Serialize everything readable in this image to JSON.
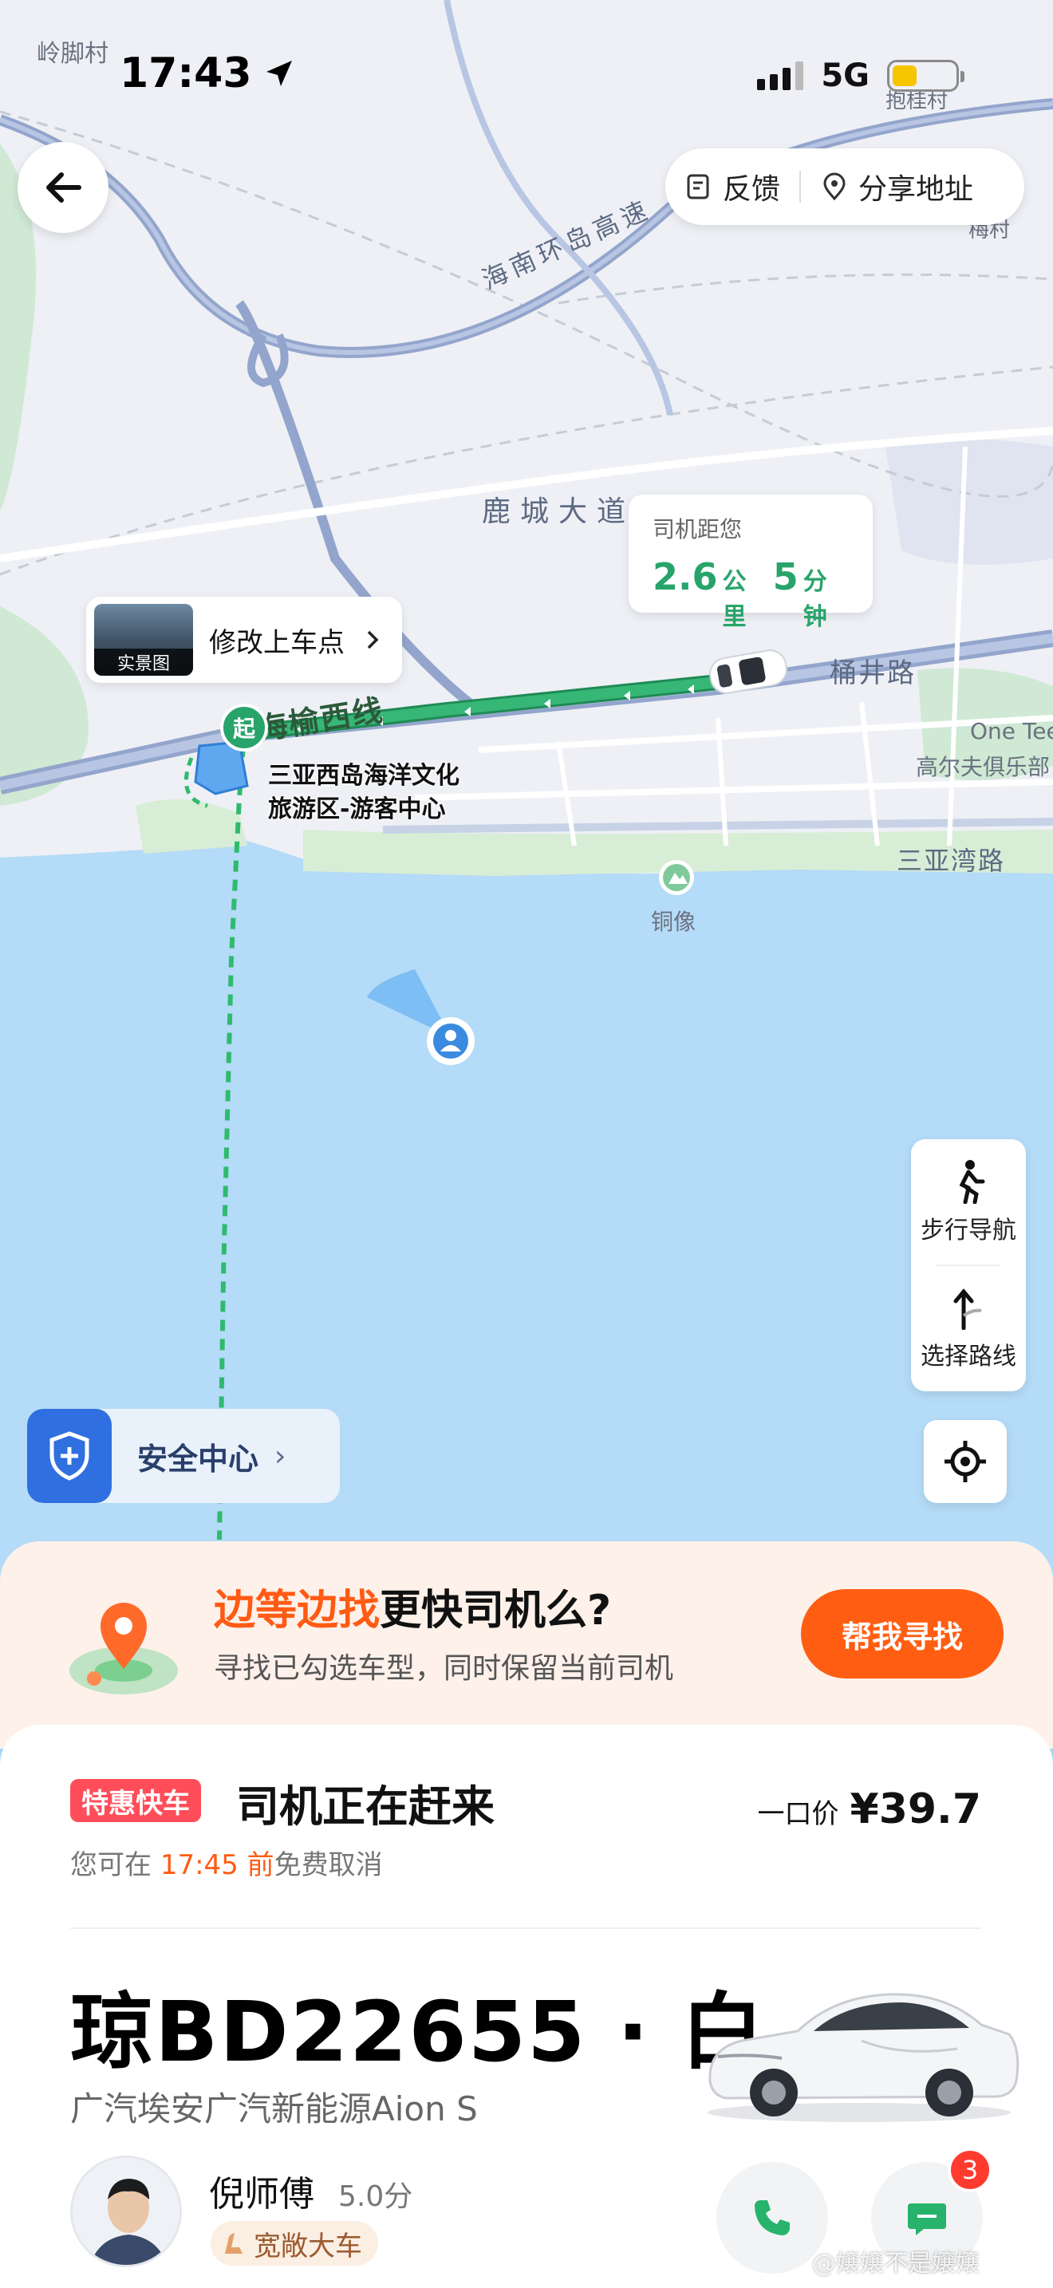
{
  "status_bar": {
    "time": "17:43",
    "network": "5G"
  },
  "map": {
    "labels": {
      "top_left_village": "岭脚村",
      "top_right_village": "抱桂村",
      "right_village": "梅村",
      "highway": "海南环岛高速",
      "lucheng": "鹿城大道",
      "yuxi": "海榆西线",
      "tongjing": "桶井路",
      "sanyawan": "三亚湾路",
      "golf": "高尔夫俱乐部",
      "golf_en": "One Tee",
      "statue": "铜像"
    },
    "pickup_marker": "起",
    "poi_line1": "三亚西岛海洋文化",
    "poi_line2": "旅游区-游客中心"
  },
  "top_actions": {
    "feedback": "反馈",
    "share": "分享地址"
  },
  "eta": {
    "title": "司机距您",
    "distance": "2.6",
    "distance_unit": "公里",
    "minutes": "5",
    "minutes_unit": "分钟"
  },
  "pickup_card": {
    "thumb_tag": "实景图",
    "label": "修改上车点"
  },
  "right_panel": {
    "walk": "步行导航",
    "route": "选择路线"
  },
  "safety": {
    "label": "安全中心"
  },
  "promo": {
    "title_highlight": "边等边找",
    "title_rest": "更快司机么?",
    "subtitle": "寻找已勾选车型，同时保留当前司机",
    "button": "帮我寻找"
  },
  "order": {
    "tag": "特惠快车",
    "status": "司机正在赶来",
    "cancel_prefix": "您可在 ",
    "cancel_time": "17:45 前",
    "cancel_suffix": "免费取消",
    "price_label": "一口价",
    "price": "¥39.7"
  },
  "car": {
    "plate": "琼BD22655 · 白",
    "model": "广汽埃安广汽新能源Aion S"
  },
  "driver": {
    "name": "倪师傅",
    "score": "5.0分",
    "badge": "宽敞大车",
    "unread_messages": "3"
  },
  "watermark": "@嬢嬢不是嬢嬢",
  "colors": {
    "route_green": "#28a46a",
    "accent_orange": "#ff5e12",
    "safety_blue": "#2f6fe0",
    "tag_red": "#ff4d5a"
  }
}
